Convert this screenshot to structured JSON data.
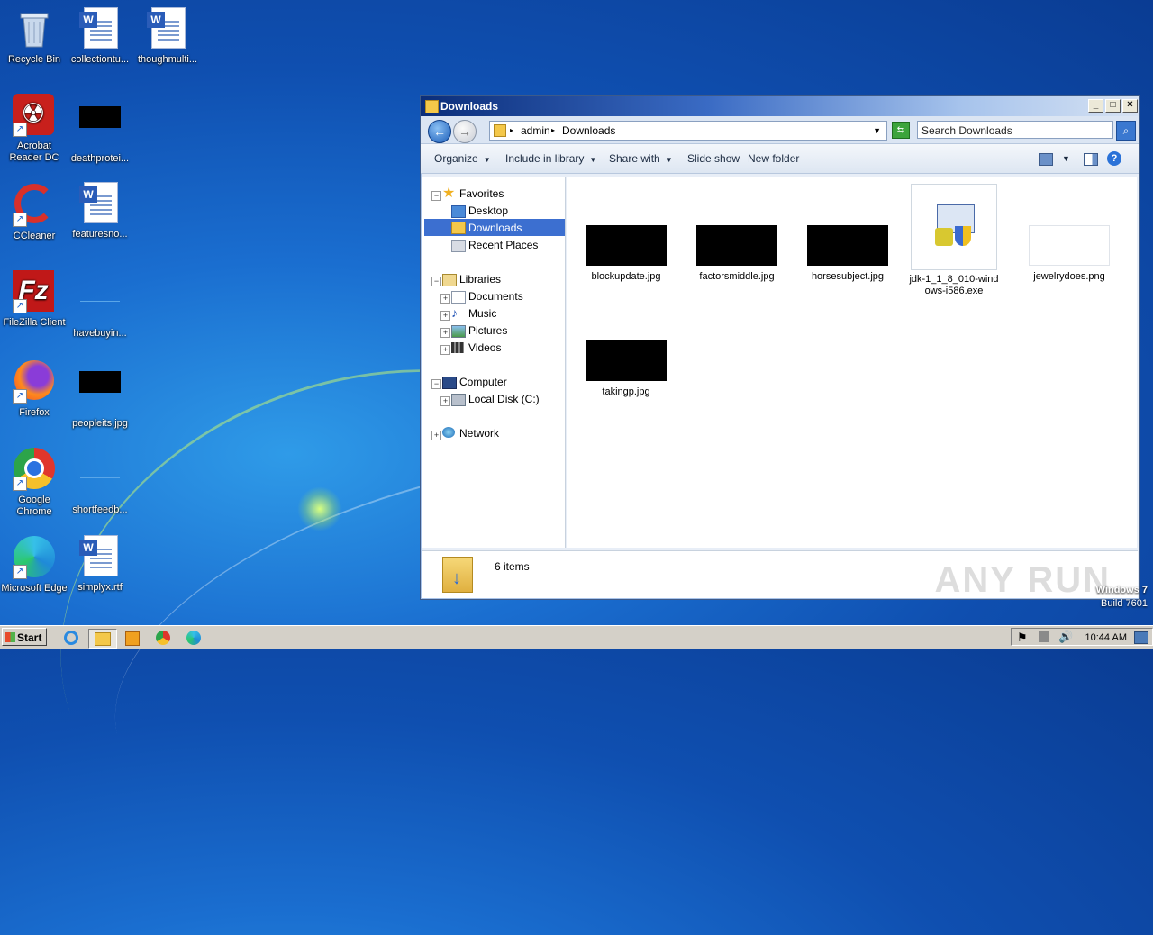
{
  "desktop": {
    "icons": [
      {
        "label": "Recycle Bin"
      },
      {
        "label": "collectiontu..."
      },
      {
        "label": "thoughmulti..."
      },
      {
        "label": "Acrobat Reader DC"
      },
      {
        "label": "deathprotei..."
      },
      {
        "label": "CCleaner"
      },
      {
        "label": "featuresno..."
      },
      {
        "label": "FileZilla Client"
      },
      {
        "label": "havebuyin..."
      },
      {
        "label": "Firefox"
      },
      {
        "label": "peopleits.jpg"
      },
      {
        "label": "Google Chrome"
      },
      {
        "label": "shortfeedb..."
      },
      {
        "label": "Microsoft Edge"
      },
      {
        "label": "simplyx.rtf"
      }
    ]
  },
  "window": {
    "title": "Downloads",
    "controls": {
      "minimize": "_",
      "maximize": "□",
      "close": "✕"
    },
    "breadcrumb": [
      "admin",
      "Downloads"
    ],
    "search_placeholder": "Search Downloads",
    "commands": [
      "Organize",
      "Include in library",
      "Share with",
      "Slide show",
      "New folder"
    ],
    "nav": {
      "favorites": "Favorites",
      "desktop": "Desktop",
      "downloads": "Downloads",
      "recent": "Recent Places",
      "libraries": "Libraries",
      "documents": "Documents",
      "music": "Music",
      "pictures": "Pictures",
      "videos": "Videos",
      "computer": "Computer",
      "local_disk": "Local Disk (C:)",
      "network": "Network"
    },
    "files": [
      {
        "name": "blockupdate.jpg"
      },
      {
        "name": "factorsmiddle.jpg"
      },
      {
        "name": "horsesubject.jpg"
      },
      {
        "name": "jdk-1_1_8_010-windows-i586.exe"
      },
      {
        "name": "jewelrydoes.png"
      },
      {
        "name": "takingp.jpg"
      }
    ],
    "status": "6 items",
    "watermark": "ANY RUN"
  },
  "os_info": {
    "line1": "Windows 7",
    "line2": "Build 7601"
  },
  "taskbar": {
    "start": "Start",
    "clock": "10:44 AM"
  },
  "colors": {
    "selection": "#3c6fd0",
    "titlebar": "#0b2e7a"
  }
}
